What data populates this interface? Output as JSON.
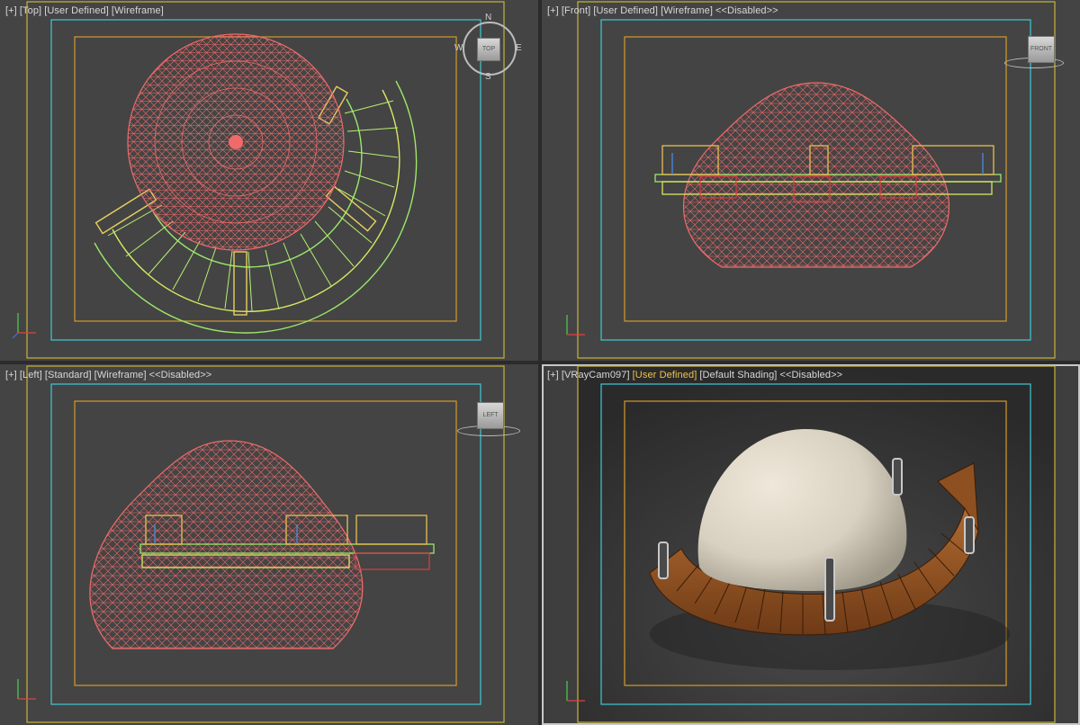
{
  "viewports": {
    "top": {
      "plus": "[+]",
      "view": "[Top]",
      "projection": "[User Defined]",
      "shading": "[Wireframe]",
      "cube": "TOP",
      "compass": {
        "n": "N",
        "s": "S",
        "e": "E",
        "w": "W"
      }
    },
    "front": {
      "plus": "[+]",
      "view": "[Front]",
      "projection": "[User Defined]",
      "shading": "[Wireframe]",
      "state": "<<Disabled>>",
      "cube": "FRONT"
    },
    "left": {
      "plus": "[+]",
      "view": "[Left]",
      "projection": "[Standard]",
      "shading": "[Wireframe]",
      "state": "<<Disabled>>",
      "cube": "LEFT"
    },
    "camera": {
      "plus": "[+]",
      "view": "[VRayCam097]",
      "projection": "[User Defined]",
      "shading": "[Default Shading]",
      "state": "<<Disabled>>"
    }
  },
  "colors": {
    "viewport_bg": "#444444",
    "safe_frame_outer": "#c8b23a",
    "safe_frame_cyan": "#3ec9d6",
    "safe_frame_inner": "#d49a2a",
    "dome_wire": "#f06a6a",
    "bench_wire": "#9be86a",
    "stone": "#d8d0c0",
    "wood": "#9a5a2a"
  }
}
